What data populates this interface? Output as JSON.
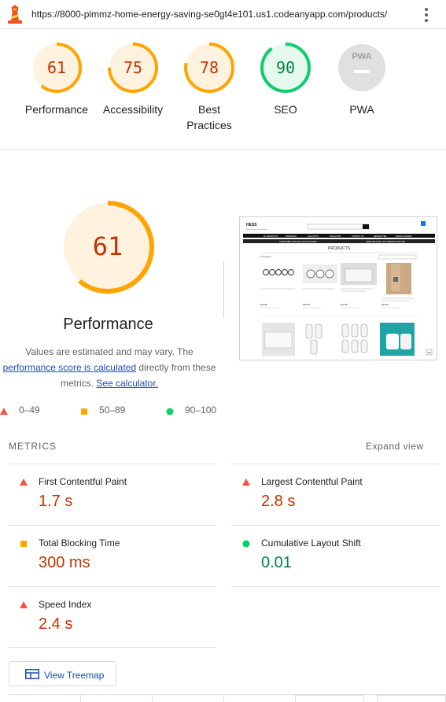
{
  "browser": {
    "url": "https://8000-pimmz-home-energy-saving-se0gt4e101.us1.codeanyapp.com/products/"
  },
  "categories": [
    {
      "label": "Performance",
      "score": "61",
      "value": 61,
      "color": "#ffa400",
      "text_color": "#c33300",
      "fill": "#fff3e0"
    },
    {
      "label": "Accessibility",
      "score": "75",
      "value": 75,
      "color": "#ffa400",
      "text_color": "#c33300",
      "fill": "#fff3e0"
    },
    {
      "label": "Best Practices",
      "score": "78",
      "value": 78,
      "color": "#ffa400",
      "text_color": "#c33300",
      "fill": "#fff3e0"
    },
    {
      "label": "SEO",
      "score": "90",
      "value": 90,
      "color": "#0cce6b",
      "text_color": "#018642",
      "fill": "#e6f9ee"
    },
    {
      "label": "PWA",
      "score": "PWA",
      "value": 0,
      "color": "#e0e0e0",
      "text_color": "#9e9e9e",
      "fill": "#e0e0e0"
    }
  ],
  "performance": {
    "score": "61",
    "value": 61,
    "title": "Performance",
    "note_prefix": "Values are estimated and may vary. The ",
    "note_link": "performance score is calculated",
    "note_middle": " directly from these metrics. ",
    "note_calc": "See calculator."
  },
  "legend": [
    {
      "range": "0–49",
      "shape": "triangle-icon",
      "color": "#ff4e42"
    },
    {
      "range": "50–89",
      "shape": "square-icon",
      "color": "#ffa400"
    },
    {
      "range": "90–100",
      "shape": "circle-icon",
      "color": "#0cce6b"
    }
  ],
  "metrics": {
    "heading": "METRICS",
    "expand": "Expand view",
    "items": [
      {
        "title": "First Contentful Paint",
        "value": "1.7 s",
        "status": "fail",
        "icon": "triangle-icon"
      },
      {
        "title": "Largest Contentful Paint",
        "value": "2.8 s",
        "status": "fail",
        "icon": "triangle-icon"
      },
      {
        "title": "Total Blocking Time",
        "value": "300 ms",
        "status": "average",
        "icon": "square-icon"
      },
      {
        "title": "Cumulative Layout Shift",
        "value": "0.01",
        "status": "pass",
        "icon": "circle-icon"
      },
      {
        "title": "Speed Index",
        "value": "2.4 s",
        "status": "fail",
        "icon": "triangle-icon"
      }
    ]
  },
  "treemap": {
    "label": "View Treemap"
  },
  "screenshot": {
    "brand": "HESS",
    "tagline": "Home Energy Saving Store",
    "nav": [
      "ALL PRODUCTS",
      "RADIATORS",
      "LED LIGHTS",
      "INSULATION",
      "CONTACT US",
      "NEWSLETTER",
      "SPECIAL OFFERS"
    ],
    "banner": "SUBSCRIBE FOR EXCLUSIVE OFFERS",
    "banner2": "FREE DELIVERY ON ORDERS OVER £50",
    "heading": "PRODUCTS",
    "products_count": "12 Products",
    "prices": [
      "£49.99",
      "£39.99",
      "£22.99",
      "£35.00"
    ]
  }
}
